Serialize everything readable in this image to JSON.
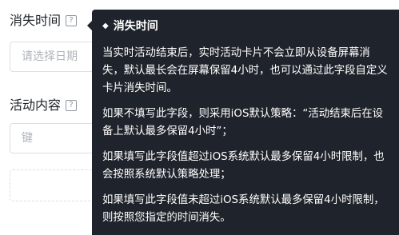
{
  "form": {
    "field1_label": "消失时间",
    "field1_help_icon": "?",
    "field1_placeholder": "请选择日期",
    "field2_label": "活动内容",
    "field2_help_icon": "?",
    "field2_placeholder": "键"
  },
  "tooltip": {
    "icon": "◆",
    "title": "消失时间",
    "paragraphs": [
      "当实时活动结束后，实时活动卡片不会立即从设备屏幕消失，默认最长会在屏幕保留4小时，也可以通过此字段自定义卡片消失时间。",
      "如果不填写此字段，则采用iOS默认策略：“活动结束后在设备上默认最多保留4小时”；",
      "如果填写此字段值超过iOS系统默认最多保留4小时限制，也会按照系统默认策略处理；",
      "如果填写此字段值未超过iOS系统默认最多保留4小时限制，则按照您指定的时间消失。"
    ]
  }
}
